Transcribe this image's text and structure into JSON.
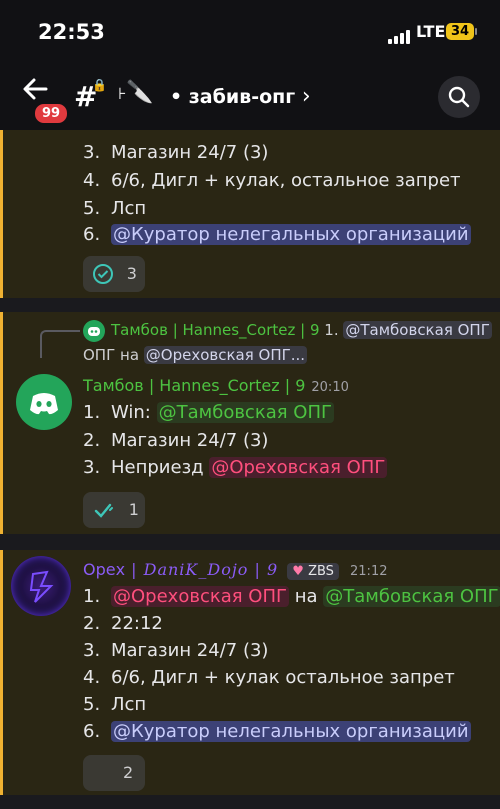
{
  "status": {
    "time": "22:53",
    "network": "LTE",
    "battery": "34"
  },
  "header": {
    "unread_badge": "99",
    "channel_emoji": "🔪",
    "channel_name": "• забив-опг",
    "chevron": "›"
  },
  "message1": {
    "items": [
      {
        "n": "3.",
        "text": "Магазин 24/7 (3)"
      },
      {
        "n": "4.",
        "text": "6/6, Дигл + кулак, остальное запрет"
      },
      {
        "n": "5.",
        "text": "Лсп"
      },
      {
        "n": "6.",
        "mention": "@Куратор нелегальных организаций"
      }
    ],
    "reaction": {
      "emoji": "✓",
      "count": "3"
    }
  },
  "message2": {
    "reply_author": "Тамбов | Hannes_Cortez | 9",
    "reply_snippet_n": "1.",
    "reply_mention1": "@Тамбовская ОПГ",
    "reply_connector": "на",
    "reply_mention2": "@Ореховская ОПГ...",
    "author": "Тамбов | Hannes_Cortez | 9",
    "time": "20:10",
    "items": [
      {
        "n": "1.",
        "prefix": "Win: ",
        "mention": "@Тамбовская ОПГ"
      },
      {
        "n": "2.",
        "text": "Магазин 24/7 (3)"
      },
      {
        "n": "3.",
        "prefix": "Неприезд ",
        "mention": "@Ореховская ОПГ"
      }
    ],
    "reaction": {
      "emoji": "✓",
      "count": "1"
    }
  },
  "message3": {
    "author_prefix": "Орех",
    "author_styled": " | DaniK_Dojo | 9",
    "tag": "ZBS",
    "time": "21:12",
    "items": [
      {
        "n": "1.",
        "mention_a": "@Ореховская ОПГ",
        "connector": " на ",
        "mention_b": "@Тамбовская ОПГ"
      },
      {
        "n": "2.",
        "text": "22:12"
      },
      {
        "n": "3.",
        "text": "Магазин 24/7 (3)"
      },
      {
        "n": "4.",
        "text": "6/6, Дигл + кулак остальное запрет"
      },
      {
        "n": "5.",
        "text": "Лсп"
      },
      {
        "n": "6.",
        "mention": "@Куратор нелегальных организаций"
      }
    ],
    "reaction": {
      "count": "2"
    }
  },
  "colors": {
    "accent_left_bar": "#f0b232",
    "green_role": "#4dc341",
    "purple_role": "#8b5cf6",
    "red_mention": "#ff4f7d"
  }
}
